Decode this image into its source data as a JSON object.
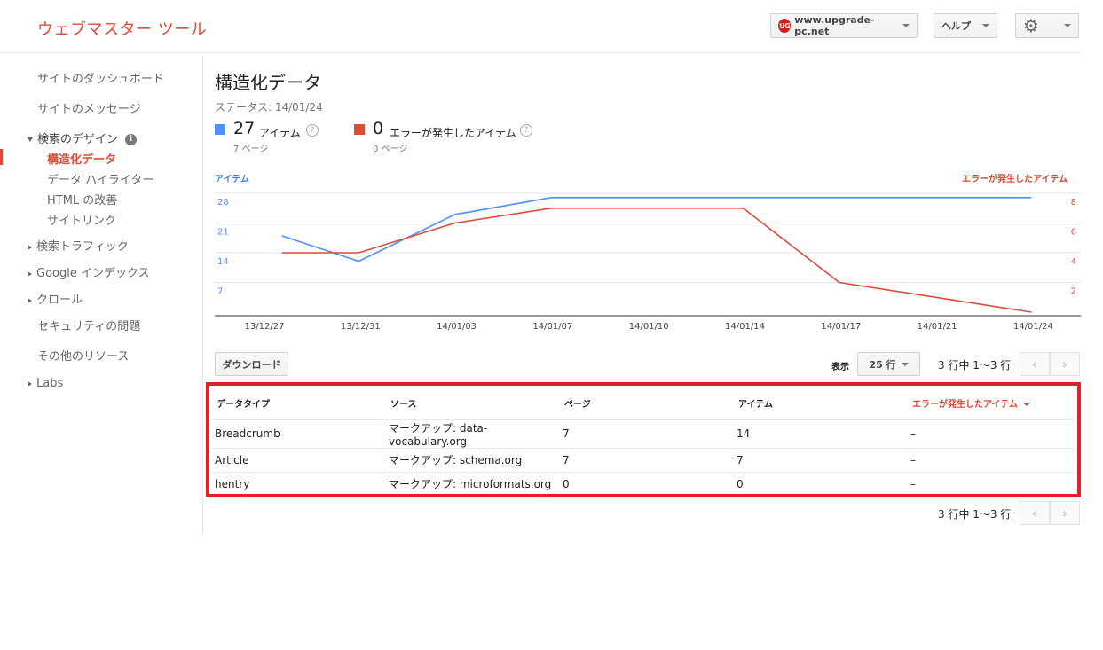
{
  "header": {
    "app_title": "ウェブマスター ツール",
    "site_logo": "UG",
    "site": "www.upgrade-pc.net",
    "help": "ヘルプ",
    "gear_icon": "⚙"
  },
  "sidebar": {
    "dashboard": "サイトのダッシュボード",
    "messages": "サイトのメッセージ",
    "search_design": "検索のデザイン",
    "info": "i",
    "structured_data": "構造化データ",
    "data_highlighter": "データ ハイライター",
    "html_improvements": "HTML の改善",
    "sitelinks": "サイトリンク",
    "search_traffic": "検索トラフィック",
    "google_index": "Google インデックス",
    "crawl": "クロール",
    "security": "セキュリティの問題",
    "other_resources": "その他のリソース",
    "labs": "Labs"
  },
  "main": {
    "title": "構造化データ",
    "status": "ステータス: 14/01/24",
    "items_count": "27",
    "items_label": "アイテム",
    "items_pages": "7 ページ",
    "errors_count": "0",
    "errors_label": "エラーが発生したアイテム",
    "errors_pages": "0 ページ",
    "help_q": "?",
    "download": "ダウンロード",
    "show_label": "表示",
    "rows_value": "25 行",
    "pager_summary": "3 行中 1〜3 行",
    "prev": "‹",
    "next": "›"
  },
  "colors": {
    "items": "#4d90fe",
    "errors": "#dd4b39"
  },
  "chart_data": {
    "type": "line",
    "left_axis_label": "アイテム",
    "right_axis_label": "エラーが発生したアイテム",
    "categories": [
      "13/12/27",
      "13/12/31",
      "14/01/03",
      "14/01/07",
      "14/01/10",
      "14/01/14",
      "14/01/17",
      "14/01/21",
      "14/01/24"
    ],
    "left_ticks": [
      "28",
      "21",
      "14",
      "7"
    ],
    "right_ticks": [
      "8",
      "6",
      "4",
      "2"
    ],
    "ylim_left": [
      0,
      28
    ],
    "ylim_right": [
      0,
      8
    ],
    "grid": true,
    "series": [
      {
        "name": "アイテム",
        "axis": "left",
        "color": "#4d90fe",
        "x": [
          0.2,
          1.0,
          2.0,
          3.0,
          4.0,
          5.0,
          6.0,
          7.0,
          8.0
        ],
        "values": [
          18,
          12,
          23,
          27,
          27,
          27,
          27,
          27,
          27
        ]
      },
      {
        "name": "エラーが発生したアイテム",
        "axis": "right",
        "color": "#dd4b39",
        "x": [
          0.2,
          1.0,
          2.0,
          3.0,
          4.0,
          5.0,
          6.0,
          8.0
        ],
        "values": [
          4,
          4,
          6,
          7,
          7,
          7,
          2,
          0
        ]
      }
    ]
  },
  "table": {
    "headers": [
      "データタイプ",
      "ソース",
      "ページ",
      "アイテム",
      "エラーが発生したアイテム"
    ],
    "rows": [
      [
        "Breadcrumb",
        "マークアップ: data-vocabulary.org",
        "7",
        "14",
        "–"
      ],
      [
        "Article",
        "マークアップ: schema.org",
        "7",
        "7",
        "–"
      ],
      [
        "hentry",
        "マークアップ: microformats.org",
        "0",
        "0",
        "–"
      ]
    ]
  }
}
